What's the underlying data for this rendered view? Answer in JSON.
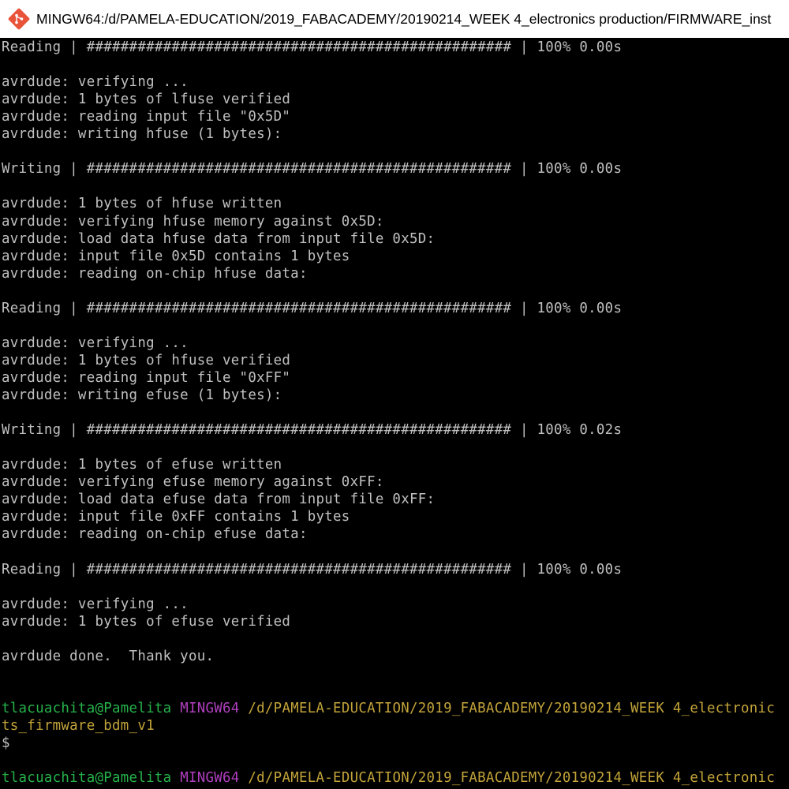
{
  "window": {
    "title": "MINGW64:/d/PAMELA-EDUCATION/2019_FABACADEMY/20190214_WEEK 4_electronics production/FIRMWARE_inst",
    "icon": "git-bash-icon"
  },
  "console": {
    "colors": {
      "background": "#000000",
      "text": "#c0c0c0",
      "prompt_user": "#26b34a",
      "prompt_host": "#b03fbf",
      "prompt_path": "#c3a43a"
    },
    "lines": [
      {
        "text": "Reading | ################################################## | 100% 0.00s"
      },
      {
        "text": ""
      },
      {
        "text": "avrdude: verifying ..."
      },
      {
        "text": "avrdude: 1 bytes of lfuse verified"
      },
      {
        "text": "avrdude: reading input file \"0x5D\""
      },
      {
        "text": "avrdude: writing hfuse (1 bytes):"
      },
      {
        "text": ""
      },
      {
        "text": "Writing | ################################################## | 100% 0.00s"
      },
      {
        "text": ""
      },
      {
        "text": "avrdude: 1 bytes of hfuse written"
      },
      {
        "text": "avrdude: verifying hfuse memory against 0x5D:"
      },
      {
        "text": "avrdude: load data hfuse data from input file 0x5D:"
      },
      {
        "text": "avrdude: input file 0x5D contains 1 bytes"
      },
      {
        "text": "avrdude: reading on-chip hfuse data:"
      },
      {
        "text": ""
      },
      {
        "text": "Reading | ################################################## | 100% 0.00s"
      },
      {
        "text": ""
      },
      {
        "text": "avrdude: verifying ..."
      },
      {
        "text": "avrdude: 1 bytes of hfuse verified"
      },
      {
        "text": "avrdude: reading input file \"0xFF\""
      },
      {
        "text": "avrdude: writing efuse (1 bytes):"
      },
      {
        "text": ""
      },
      {
        "text": "Writing | ################################################## | 100% 0.02s"
      },
      {
        "text": ""
      },
      {
        "text": "avrdude: 1 bytes of efuse written"
      },
      {
        "text": "avrdude: verifying efuse memory against 0xFF:"
      },
      {
        "text": "avrdude: load data efuse data from input file 0xFF:"
      },
      {
        "text": "avrdude: input file 0xFF contains 1 bytes"
      },
      {
        "text": "avrdude: reading on-chip efuse data:"
      },
      {
        "text": ""
      },
      {
        "text": "Reading | ################################################## | 100% 0.00s"
      },
      {
        "text": ""
      },
      {
        "text": "avrdude: verifying ..."
      },
      {
        "text": "avrdude: 1 bytes of efuse verified"
      },
      {
        "text": ""
      },
      {
        "text": "avrdude done.  Thank you."
      },
      {
        "text": ""
      },
      {
        "text": ""
      },
      {
        "prompt": {
          "user": "tlacuachita@Pamelita",
          "host": "MINGW64",
          "path": "/d/PAMELA-EDUCATION/2019_FABACADEMY/20190214_WEEK 4_electronic"
        }
      },
      {
        "text": "ts_firmware_bdm_v1",
        "style": "path"
      },
      {
        "text": "$"
      },
      {
        "text": ""
      },
      {
        "prompt": {
          "user": "tlacuachita@Pamelita",
          "host": "MINGW64",
          "path": "/d/PAMELA-EDUCATION/2019_FABACADEMY/20190214_WEEK 4_electronic"
        }
      }
    ]
  }
}
